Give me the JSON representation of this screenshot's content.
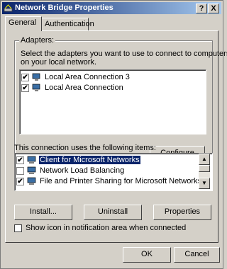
{
  "window": {
    "title": "Network Bridge Properties",
    "help_label": "?",
    "close_label": "X"
  },
  "tabs": [
    {
      "label": "General",
      "active": true
    },
    {
      "label": "Authentication",
      "active": false
    }
  ],
  "adapters": {
    "group_label": "Adapters:",
    "description_line1": "Select the adapters you want to use to connect to computers",
    "description_line2": "on your local network.",
    "items": [
      {
        "label": "Local Area Connection 3",
        "checked": true
      },
      {
        "label": "Local Area Connection",
        "checked": true
      }
    ],
    "configure_label": "Configure"
  },
  "components": {
    "heading": "This connection uses the following items:",
    "items": [
      {
        "label": "Client for Microsoft Networks",
        "checked": true,
        "selected": true
      },
      {
        "label": "Network Load Balancing",
        "checked": false,
        "selected": false
      },
      {
        "label": "File and Printer Sharing for Microsoft Networks",
        "checked": true,
        "selected": false
      }
    ],
    "install_label": "Install...",
    "uninstall_label": "Uninstall",
    "properties_label": "Properties"
  },
  "show_icon": {
    "label": "Show icon in notification area when connected",
    "checked": false
  },
  "footer": {
    "ok_label": "OK",
    "cancel_label": "Cancel"
  },
  "colors": {
    "titlebar_start": "#0a246a",
    "titlebar_end": "#a6caf0",
    "face": "#d4d0c8",
    "selection": "#0a246a"
  }
}
